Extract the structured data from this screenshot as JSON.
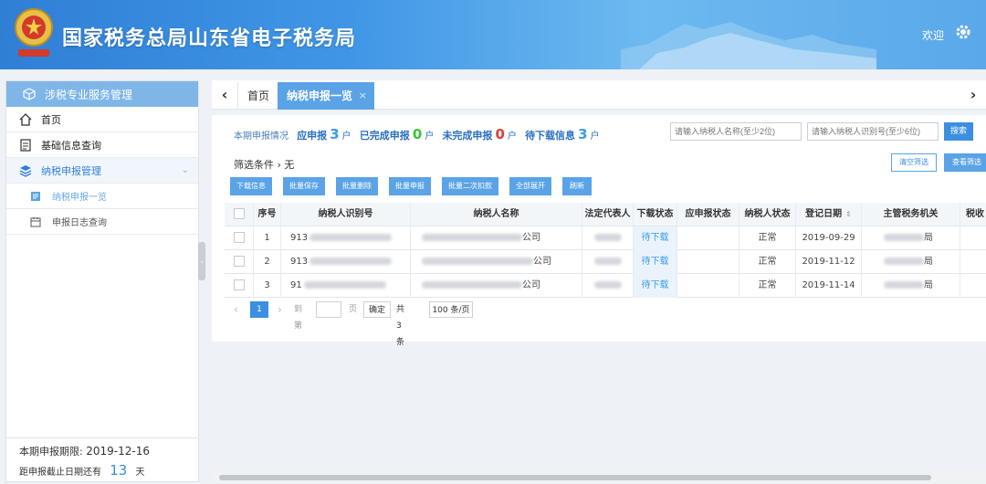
{
  "header": {
    "title": "国家税务总局山东省电子税务局",
    "welcome": "欢迎",
    "logo_icon": "tax-emblem-icon",
    "settings_icon": "gear-icon"
  },
  "sidebar": {
    "section_title": "涉税专业服务管理",
    "items": [
      {
        "label": "首页",
        "icon": "home-icon"
      },
      {
        "label": "基础信息查询",
        "icon": "document-icon"
      },
      {
        "label": "纳税申报管理",
        "icon": "layers-icon"
      }
    ],
    "subitems": [
      {
        "label": "纳税申报一览",
        "icon": "file-icon"
      },
      {
        "label": "申报日志查询",
        "icon": "calendar-icon"
      }
    ],
    "footer": {
      "deadline_label": "本期申报期限:",
      "deadline_value": "2019-12-16",
      "remaining_prefix": "距申报截止日期还有",
      "remaining_days": "13",
      "remaining_suffix": "天"
    }
  },
  "tabs": {
    "home": "首页",
    "current": "纳税申报一览",
    "close": "×"
  },
  "summary": {
    "prefix": "本期申报情况",
    "should_label": "应申报",
    "should_count": "3",
    "done_label": "已完成申报",
    "done_count": "0",
    "undone_label": "未完成申报",
    "undone_count": "0",
    "pending_label": "待下载信息",
    "pending_count": "3",
    "unit": "户"
  },
  "search": {
    "name_placeholder": "请输入纳税人名称(至少2位)",
    "id_placeholder": "请输入纳税人识别号(至少6位)",
    "search_button": "搜索"
  },
  "filter": {
    "label": "筛选条件 › 无",
    "clear_button": "清空筛选",
    "view_button": "查看筛选"
  },
  "actions": [
    "下载信息",
    "批量保存",
    "批量删除",
    "批量申报",
    "批量二次扣款",
    "全部展开",
    "刷新"
  ],
  "table": {
    "headers": [
      "序号",
      "纳税人识别号",
      "纳税人名称",
      "法定代表人",
      "下载状态",
      "应申报状态",
      "纳税人状态",
      "登记日期",
      "主管税务机关",
      "税收"
    ],
    "rows": [
      {
        "no": "1",
        "id_prefix": "913",
        "name_suffix": "公司",
        "download": "待下载",
        "status": "正常",
        "date": "2019-09-29",
        "office_suffix": "局"
      },
      {
        "no": "2",
        "id_prefix": "913",
        "name_suffix": "公司",
        "download": "待下载",
        "status": "正常",
        "date": "2019-11-12",
        "office_suffix": "局"
      },
      {
        "no": "3",
        "id_prefix": "91",
        "name_suffix": "公司",
        "download": "待下载",
        "status": "正常",
        "date": "2019-11-14",
        "office_suffix": "局"
      }
    ]
  },
  "pagination": {
    "prev": "‹",
    "current_page": "1",
    "next": "›",
    "goto_label": "到第",
    "page_unit": "页",
    "confirm": "确定",
    "total": "共 3 条",
    "page_size": "100 条/页"
  },
  "colors": {
    "header_blue": "#2f7fd6",
    "accent_blue": "#5aa3e6",
    "count_green": "#3cc23a",
    "count_red": "#e33b3b"
  }
}
